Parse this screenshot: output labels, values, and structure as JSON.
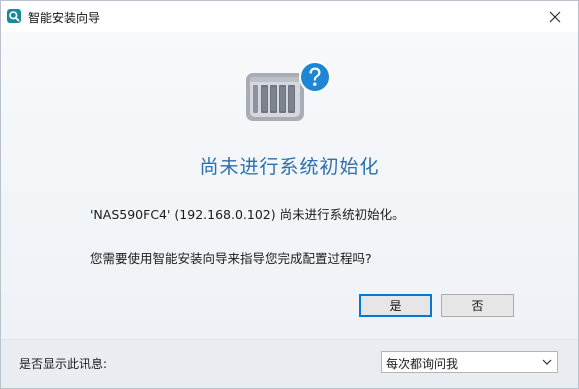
{
  "window": {
    "title": "智能安装向导"
  },
  "main": {
    "headline": "尚未进行系统初始化",
    "message": "'NAS590FC4' (192.168.0.102) 尚未进行系统初始化。",
    "question": "您需要使用智能安装向导来指导您完成配置过程吗?"
  },
  "buttons": {
    "yes": "是",
    "no": "否"
  },
  "footer": {
    "label": "是否显示此讯息:",
    "select_value": "每次都询问我"
  },
  "icons": {
    "app": "app-search-icon",
    "close": "close-icon",
    "nas": "nas-device-question-icon",
    "dropdown": "chevron-down-icon"
  },
  "colors": {
    "headline": "#2e6fab",
    "accent": "#0078d7",
    "question_badge": "#1f86d6"
  }
}
